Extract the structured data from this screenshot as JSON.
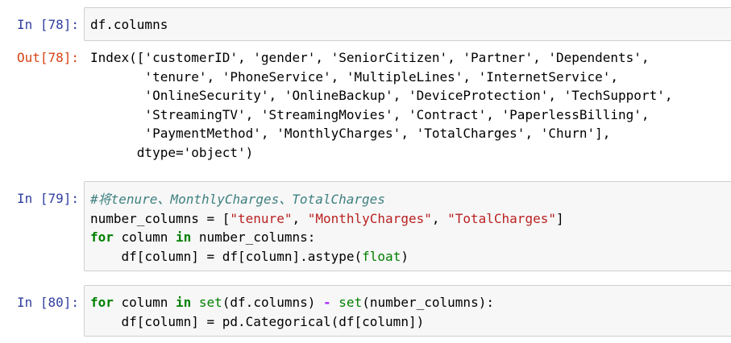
{
  "cells": [
    {
      "prompt": "In  [78]:",
      "lines": [
        "df.columns"
      ]
    },
    {
      "prompt": "Out[78]:",
      "lines": [
        "Index(['customerID', 'gender', 'SeniorCitizen', 'Partner', 'Dependents',",
        "       'tenure', 'PhoneService', 'MultipleLines', 'InternetService',",
        "       'OnlineSecurity', 'OnlineBackup', 'DeviceProtection', 'TechSupport',",
        "       'StreamingTV', 'StreamingMovies', 'Contract', 'PaperlessBilling',",
        "       'PaymentMethod', 'MonthlyCharges', 'TotalCharges', 'Churn'],",
        "      dtype='object')"
      ]
    },
    {
      "prompt": "In  [79]:",
      "tokens": [
        {
          "comment": "#将tenure、MonthlyCharges、TotalCharges"
        },
        {
          "a": "number_columns = [",
          "s1": "\"tenure\"",
          "c1": ", ",
          "s2": "\"MonthlyCharges\"",
          "c2": ", ",
          "s3": "\"TotalCharges\"",
          "end": "]"
        },
        {
          "kw1": "for",
          "mid": " column ",
          "kw2": "in",
          "rest": " number_columns:"
        },
        {
          "indent": "    ",
          "a": "df[column] = df[column].astype(",
          "bi": "float",
          "end": ")"
        }
      ]
    },
    {
      "prompt": "In  [80]:",
      "tokens": [
        {
          "kw1": "for",
          "mid": " column ",
          "kw2": "in",
          "sp": " ",
          "bi1": "set",
          "a": "(df.columns) ",
          "op": "-",
          "sp2": " ",
          "bi2": "set",
          "rest": "(number_columns):"
        },
        {
          "indent": "    ",
          "a": "df[column] = pd.Categorical(df[column])"
        }
      ]
    }
  ]
}
